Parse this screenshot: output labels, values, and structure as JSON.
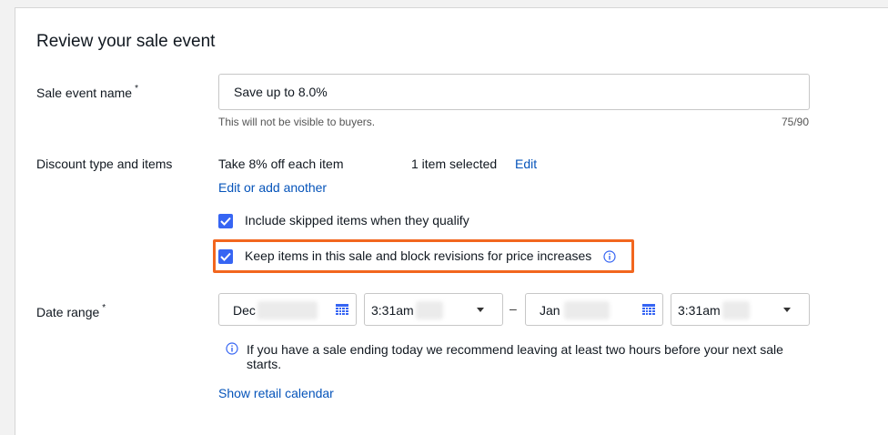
{
  "page": {
    "title": "Review your sale event"
  },
  "sale_name": {
    "label": "Sale event name",
    "required_mark": "*",
    "value": "Save up to 8.0%",
    "help": "This will not be visible to buyers.",
    "counter": "75/90"
  },
  "discount": {
    "label": "Discount type and items",
    "type_text": "Take 8% off each item",
    "items_text": "1 item selected",
    "edit_link": "Edit",
    "edit_add_link": "Edit or add another",
    "checkbox_skipped": {
      "label": "Include skipped items when they qualify",
      "checked": true
    },
    "checkbox_block": {
      "label": "Keep items in this sale and block revisions for price increases",
      "checked": true
    }
  },
  "date_range": {
    "label": "Date range",
    "required_mark": "*",
    "start_date": "Dec",
    "start_time": "3:31am",
    "separator": "–",
    "end_date": "Jan",
    "end_time": "3:31am",
    "info_text_line1": "If you have a sale ending today we recommend leaving at least two hours before your next sale",
    "info_text_line2": "starts.",
    "calendar_link": "Show retail calendar"
  },
  "colors": {
    "accent": "#3665f3",
    "link": "#0654ba",
    "highlight": "#f2661e"
  },
  "icons": [
    "checkmark-icon",
    "info-icon",
    "calendar-icon",
    "chevron-down-icon"
  ]
}
